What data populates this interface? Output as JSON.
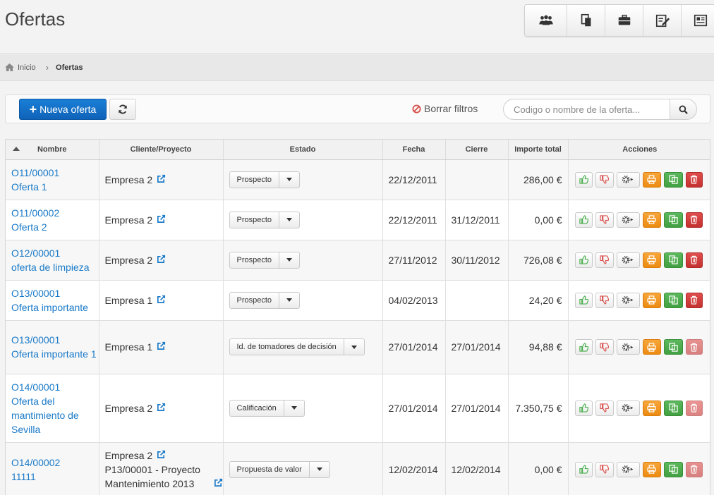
{
  "header": {
    "title": "Ofertas",
    "toolbar": [
      {
        "id": "team",
        "icon": "people-icon"
      },
      {
        "id": "documents",
        "icon": "documents-icon"
      },
      {
        "id": "briefcase",
        "icon": "briefcase-icon"
      },
      {
        "id": "edit",
        "icon": "edit-note-icon"
      },
      {
        "id": "contact",
        "icon": "contact-card-icon"
      }
    ]
  },
  "breadcrumb": {
    "home": "Inicio",
    "current": "Ofertas"
  },
  "filters": {
    "new_label": "Nueva oferta",
    "clear_label": "Borrar filtros",
    "search_placeholder": "Codigo o nombre de la oferta..."
  },
  "colors": {
    "primary": "#1a7fd6",
    "link": "#1a7ac8",
    "success_icon": "#4caf50",
    "danger_icon": "#d9534f",
    "print": "#f0961f",
    "copy": "#4cae4c",
    "delete": "#d43f3f"
  },
  "table": {
    "columns": [
      "Nombre",
      "Cliente/Proyecto",
      "Estado",
      "Fecha",
      "Cierre",
      "Importe total",
      "Acciones"
    ],
    "rows": [
      {
        "code": "O11/00001",
        "name": "Oferta 1",
        "client": "Empresa 2",
        "project": "",
        "state": "Prospecto",
        "date": "22/12/2011",
        "close": "",
        "amount": "286,00 €",
        "delete_enabled": true
      },
      {
        "code": "O11/00002",
        "name": "Oferta 2",
        "client": "Empresa 2",
        "project": "",
        "state": "Prospecto",
        "date": "22/12/2011",
        "close": "31/12/2011",
        "amount": "0,00 €",
        "delete_enabled": true
      },
      {
        "code": "O12/00001",
        "name": "oferta de limpieza",
        "client": "Empresa 2",
        "project": "",
        "state": "Prospecto",
        "date": "27/11/2012",
        "close": "30/11/2012",
        "amount": "726,08 €",
        "delete_enabled": true
      },
      {
        "code": "O13/00001",
        "name": "Oferta importante",
        "client": "Empresa 1",
        "project": "",
        "state": "Prospecto",
        "date": "04/02/2013",
        "close": "",
        "amount": "24,20 €",
        "delete_enabled": true
      },
      {
        "code": "O13/00001",
        "name": "Oferta importante 1",
        "client": "Empresa 1",
        "project": "",
        "state": "Id. de tomadores de decisión",
        "date": "27/01/2014",
        "close": "27/01/2014",
        "amount": "94,88 €",
        "delete_enabled": false
      },
      {
        "code": "O14/00001",
        "name": "Oferta del mantimiento de Sevilla",
        "client": "Empresa 2",
        "project": "",
        "state": "Calificación",
        "date": "27/01/2014",
        "close": "27/01/2014",
        "amount": "7.350,75 €",
        "delete_enabled": false
      },
      {
        "code": "O14/00002",
        "name": "11111",
        "client": "Empresa 2",
        "project": "P13/00001 - Proyecto Mantenimiento 2013",
        "state": "Propuesta de valor",
        "date": "12/02/2014",
        "close": "12/02/2014",
        "amount": "0,00 €",
        "delete_enabled": false
      }
    ]
  }
}
